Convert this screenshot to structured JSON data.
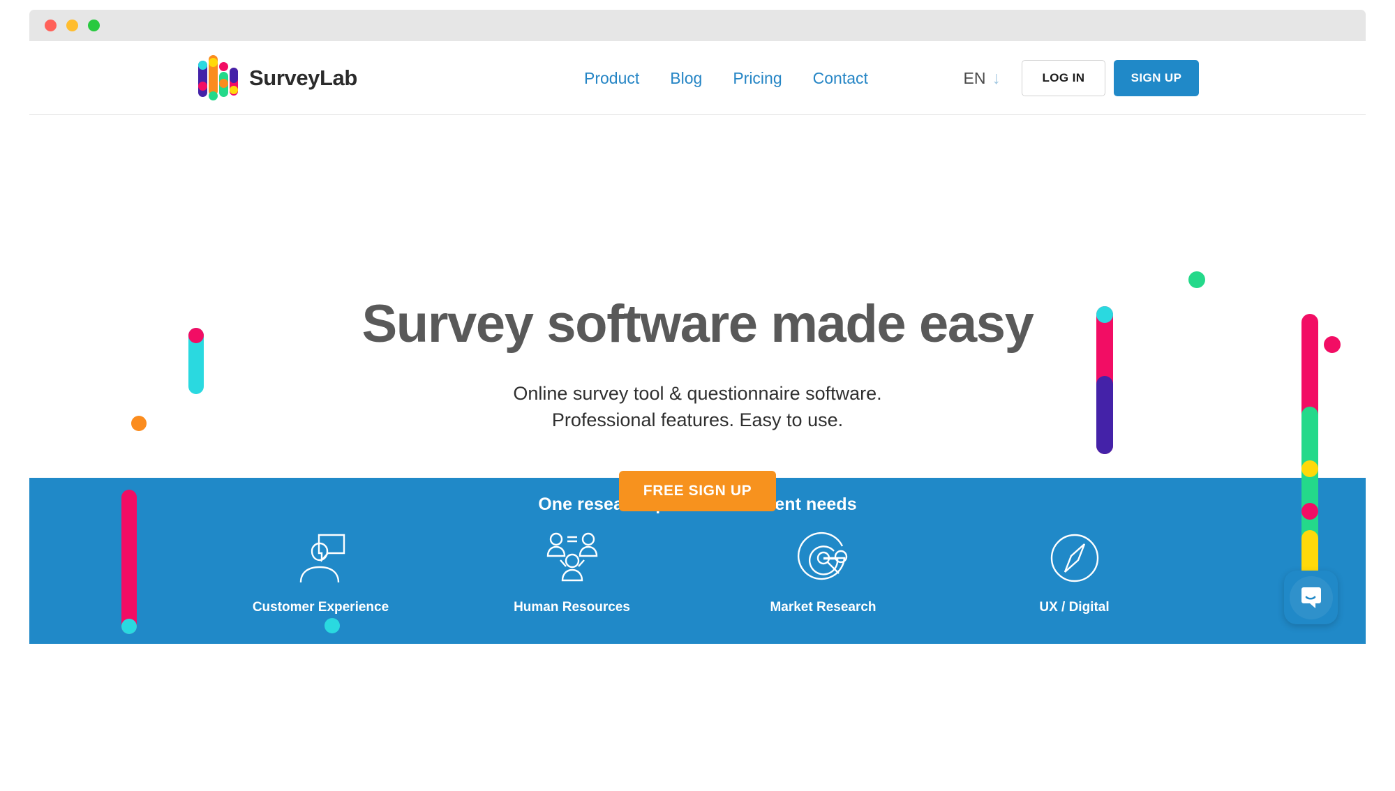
{
  "window": {
    "traffic_lights": [
      "close",
      "minimize",
      "maximize"
    ],
    "colors": {
      "close": "#ff6159",
      "minimize": "#ffbd2e",
      "maximize": "#28c93f"
    }
  },
  "header": {
    "logo_text": "SurveyLab",
    "nav": [
      {
        "label": "Product"
      },
      {
        "label": "Blog"
      },
      {
        "label": "Pricing"
      },
      {
        "label": "Contact"
      }
    ],
    "language": {
      "label": "EN",
      "arrow_icon": "arrow-down-icon"
    },
    "login_label": "LOG IN",
    "signup_label": "SIGN UP",
    "link_color": "#2585c5",
    "signup_bg": "#2089c8"
  },
  "hero": {
    "title": "Survey software made easy",
    "subtitle_line1": "Online survey tool & questionnaire software.",
    "subtitle_line2": "Professional features. Easy to use.",
    "cta_label": "FREE SIGN UP",
    "cta_color": "#f7921e",
    "title_color": "#595959"
  },
  "band": {
    "title": "One research platform different needs",
    "bg_color": "#2089c8",
    "items": [
      {
        "label": "Customer Experience",
        "icon": "person-speech-bubble-icon"
      },
      {
        "label": "Human Resources",
        "icon": "people-network-icon"
      },
      {
        "label": "Market Research",
        "icon": "target-magnifier-icon"
      },
      {
        "label": "UX / Digital",
        "icon": "compass-icon"
      }
    ]
  },
  "chat": {
    "icon": "chat-bubble-icon",
    "bg_color": "#2089c8"
  },
  "palette": {
    "pink": "#f20d64",
    "cyan": "#2ad9e0",
    "purple": "#4422a8",
    "green": "#24d98a",
    "yellow": "#ffd90a",
    "orange": "#fb8c1e"
  }
}
